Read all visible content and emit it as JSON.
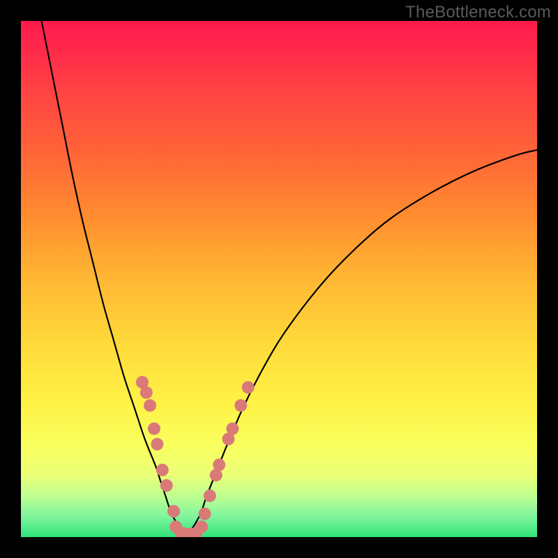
{
  "watermark": "TheBottleneck.com",
  "chart_data": {
    "type": "line",
    "title": "",
    "xlabel": "",
    "ylabel": "",
    "xlim": [
      0,
      100
    ],
    "ylim": [
      0,
      100
    ],
    "grid": false,
    "legend": false,
    "note": "Gradient background red→green top→bottom; V-shaped black curve with salmon marker points along lower center portion",
    "series": [
      {
        "name": "curve-left",
        "x": [
          4,
          6,
          8,
          10,
          12,
          14,
          16,
          18,
          20,
          22,
          24,
          26,
          27,
          28,
          29,
          30,
          31,
          32
        ],
        "y": [
          100,
          90,
          80,
          70,
          61,
          53,
          45,
          38,
          31,
          25,
          19,
          14,
          11,
          8,
          5,
          3,
          1.5,
          0.8
        ]
      },
      {
        "name": "curve-right",
        "x": [
          32,
          33,
          34,
          35,
          36,
          38,
          40,
          43,
          46,
          50,
          55,
          60,
          66,
          72,
          80,
          88,
          96,
          100
        ],
        "y": [
          0.8,
          1.5,
          3,
          5,
          8,
          13,
          18,
          25,
          31,
          38,
          45,
          51,
          57,
          62,
          67,
          71,
          74,
          75
        ]
      }
    ],
    "markers": {
      "name": "highlight-points",
      "color": "#d97a78",
      "radius_px": 9,
      "points": [
        {
          "x": 23.5,
          "y": 30
        },
        {
          "x": 24.3,
          "y": 28
        },
        {
          "x": 25.0,
          "y": 25.5
        },
        {
          "x": 25.8,
          "y": 21
        },
        {
          "x": 26.4,
          "y": 18
        },
        {
          "x": 27.4,
          "y": 13
        },
        {
          "x": 28.2,
          "y": 10
        },
        {
          "x": 29.6,
          "y": 5
        },
        {
          "x": 30.0,
          "y": 2
        },
        {
          "x": 31.0,
          "y": 0.8
        },
        {
          "x": 32.0,
          "y": 0.6
        },
        {
          "x": 33.0,
          "y": 0.6
        },
        {
          "x": 34.0,
          "y": 0.8
        },
        {
          "x": 35.0,
          "y": 2
        },
        {
          "x": 35.6,
          "y": 4.5
        },
        {
          "x": 36.6,
          "y": 8
        },
        {
          "x": 37.8,
          "y": 12
        },
        {
          "x": 38.4,
          "y": 14
        },
        {
          "x": 40.2,
          "y": 19
        },
        {
          "x": 41.0,
          "y": 21
        },
        {
          "x": 42.6,
          "y": 25.5
        },
        {
          "x": 44.0,
          "y": 29
        }
      ]
    }
  }
}
